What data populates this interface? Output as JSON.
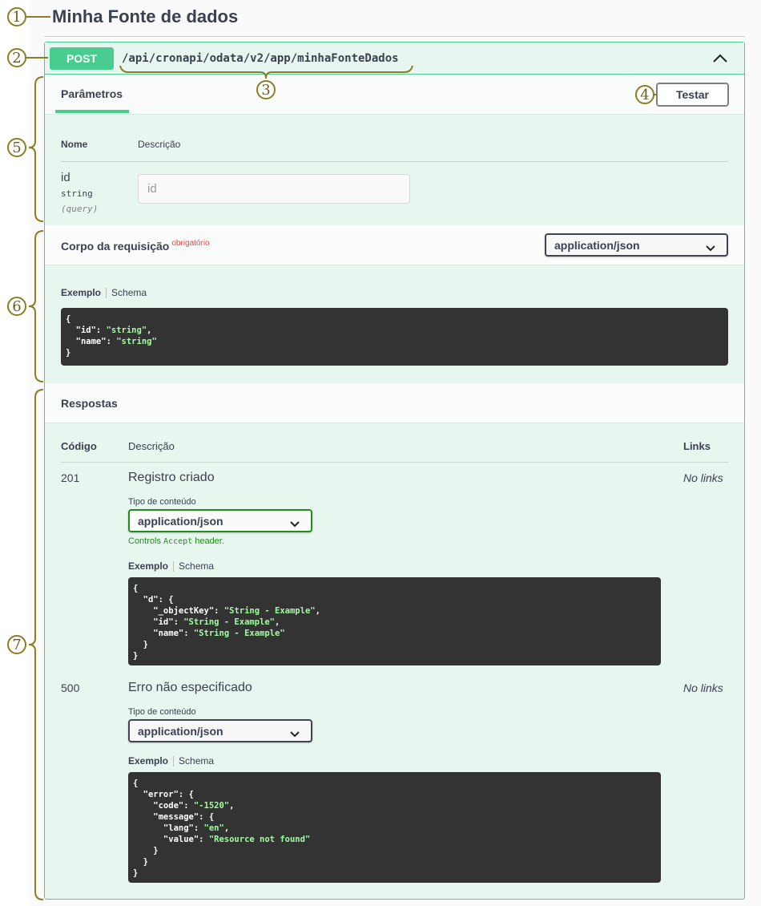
{
  "page": {
    "title": "Minha Fonte de dados"
  },
  "operation": {
    "method": "POST",
    "path": "/api/cronapi/odata/v2/app/minhaFonteDados",
    "collapse_icon": "chevron-up-icon",
    "method_color": "#49cc90"
  },
  "params_section": {
    "tab_label": "Parâmetros",
    "try_button_label": "Testar",
    "columns": [
      "Nome",
      "Descrição"
    ],
    "param": {
      "name": "id",
      "type": "string",
      "in": "(query)",
      "placeholder": "id",
      "value": ""
    }
  },
  "request_body": {
    "title": "Corpo da requisição",
    "required_label": "obrigatório",
    "content_type": "application/json",
    "example_tab": "Exemplo",
    "schema_tab": "Schema",
    "example_lines": [
      {
        "t": "{"
      },
      {
        "t": "  \"id\": ",
        "s": "\"string\"",
        "e": ","
      },
      {
        "t": "  \"name\": ",
        "s": "\"string\""
      },
      {
        "t": "}"
      }
    ]
  },
  "responses": {
    "title": "Respostas",
    "columns": {
      "code": "Código",
      "description": "Descrição",
      "links": "Links"
    },
    "items": [
      {
        "code": "201",
        "description": "Registro criado",
        "links": "No links",
        "content_type_label": "Tipo de conteúdo",
        "content_type": "application/json",
        "note_prefix": "Controls ",
        "note_code": "Accept",
        "note_suffix": " header.",
        "example_tab": "Exemplo",
        "schema_tab": "Schema",
        "example_lines": [
          {
            "t": "{"
          },
          {
            "t": "  \"d\": {"
          },
          {
            "t": "    \"_objectKey\": ",
            "s": "\"String - Example\"",
            "e": ","
          },
          {
            "t": "    \"id\": ",
            "s": "\"String - Example\"",
            "e": ","
          },
          {
            "t": "    \"name\": ",
            "s": "\"String - Example\""
          },
          {
            "t": "  }"
          },
          {
            "t": "}"
          }
        ]
      },
      {
        "code": "500",
        "description": "Erro não especificado",
        "links": "No links",
        "content_type_label": "Tipo de conteúdo",
        "content_type": "application/json",
        "example_tab": "Exemplo",
        "schema_tab": "Schema",
        "example_lines": [
          {
            "t": "{"
          },
          {
            "t": "  \"error\": {"
          },
          {
            "t": "    \"code\": ",
            "s": "\"-1520\"",
            "e": ","
          },
          {
            "t": "    \"message\": {"
          },
          {
            "t": "      \"lang\": ",
            "s": "\"en\"",
            "e": ","
          },
          {
            "t": "      \"value\": ",
            "s": "\"Resource not found\""
          },
          {
            "t": "    }"
          },
          {
            "t": "  }"
          },
          {
            "t": "}"
          }
        ]
      }
    ]
  },
  "annotations": [
    "1",
    "2",
    "3",
    "4",
    "5",
    "6",
    "7"
  ]
}
